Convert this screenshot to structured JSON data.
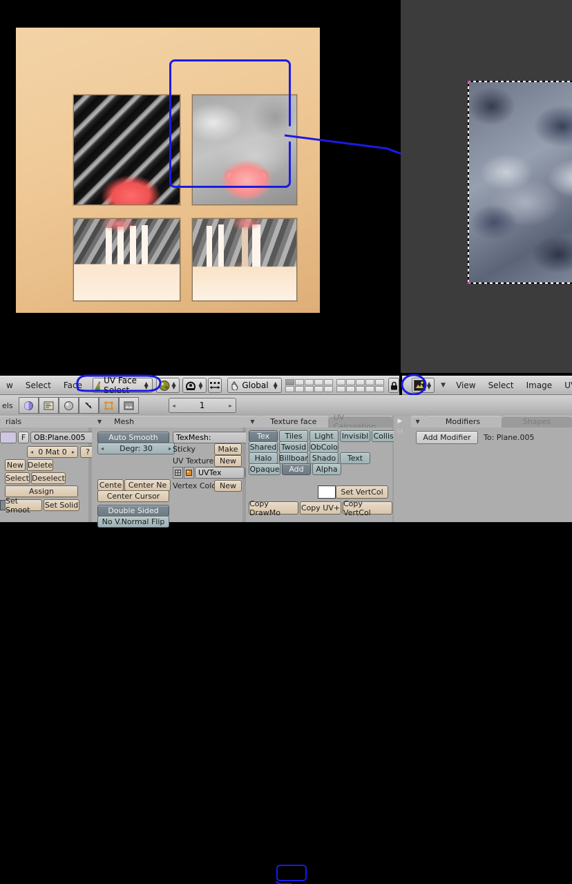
{
  "viewport3d": {
    "name": "3D View",
    "header": {
      "menus": [
        "w",
        "Select",
        "Face"
      ],
      "mode_selector": {
        "label": "UV Face Select",
        "icon": "uv-face-select-icon"
      },
      "draw_type": {
        "icon": "shading-textured-icon"
      },
      "pivot": {
        "icon": "rotate-manipulator-icon"
      },
      "manipulator": {
        "icon": "scale-manipulator-icon"
      },
      "transform_orientation": {
        "label": "Global",
        "icon": "hand-icon"
      },
      "layers_lock": {
        "icon": "lock-icon"
      },
      "layer_active_index": 0,
      "layer_count": 20
    },
    "faces": [
      {
        "name": "face-top-left",
        "label": "monkey on dark diagonal texture"
      },
      {
        "name": "face-top-right-selected",
        "label": "monkey on cloud texture"
      },
      {
        "name": "face-bottom-left",
        "label": "columns scene A"
      },
      {
        "name": "face-bottom-right",
        "label": "columns scene B"
      }
    ],
    "annotations": {
      "selection_box": "blue freehand box around selected face",
      "arrow": "blue arrow from selected face to image editor"
    }
  },
  "uv_editor": {
    "name": "UV/Image Editor",
    "header": {
      "editor_type_icon": "uv-image-editor-icon",
      "collapse_icon": "chevron-down-icon",
      "menus": [
        "View",
        "Select",
        "Image",
        "UVs"
      ]
    },
    "image": {
      "label": "cloud texture",
      "selected": true
    }
  },
  "buttons_header": {
    "left_label": "els",
    "context_icons": [
      {
        "name": "scene-icon",
        "active": false
      },
      {
        "name": "object-icon",
        "active": false
      },
      {
        "name": "shading-icon",
        "active": false
      },
      {
        "name": "object-constraints-icon",
        "active": false
      },
      {
        "name": "editing-icon",
        "active": true
      },
      {
        "name": "scripts-icon",
        "active": false
      }
    ],
    "frame_field": {
      "value": "1",
      "left_arrow": "◂",
      "right_arrow": "▸"
    }
  },
  "panels": {
    "link_and_materials": {
      "tab_label": "rials",
      "object_field": {
        "prefix": "F",
        "value": "OB:Plane.005"
      },
      "material_index": {
        "label": "0 Mat 0",
        "left_arrow": "◂",
        "right_arrow": "▸"
      },
      "help_button": "?",
      "buttons": [
        "New",
        "Delete",
        "Select",
        "Deselect"
      ],
      "assign": "Assign",
      "set_smooth": "Set Smoot",
      "set_solid": "Set Solid"
    },
    "mesh": {
      "tab_label": "Mesh",
      "auto_smooth": "Auto Smooth",
      "degr": {
        "label": "Degr: 30",
        "left_arrow": "◂",
        "right_arrow": "▸"
      },
      "center": "Cente",
      "center_new": "Center Ne",
      "center_cursor": "Center Cursor",
      "double_sided": "Double Sided",
      "no_vnormal_flip": "No V.Normal Flip",
      "texmesh": "TexMesh:",
      "sticky_label": "Sticky",
      "sticky_button": "Make",
      "uv_texture_label": "UV Texture",
      "uv_texture_button": "New",
      "uvtex_entry": "UVTex",
      "uvtex_delete_icon": "x-icon",
      "uvtex_grid_icon": "grid-icon",
      "uvtex_image_icon": "image-icon",
      "vertex_color_label": "Vertex Color",
      "vertex_color_button": "New"
    },
    "texture_face": {
      "tab_label": "Texture face",
      "tab_inactive_label": "UV Calculation",
      "row1": [
        {
          "label": "Tex",
          "active": true
        },
        {
          "label": "Tiles",
          "active": false
        },
        {
          "label": "Light",
          "active": false
        },
        {
          "label": "Invisibl",
          "active": false
        },
        {
          "label": "Collisio",
          "active": false
        }
      ],
      "row2": [
        {
          "label": "Shared",
          "active": false
        },
        {
          "label": "Twosid",
          "active": false
        },
        {
          "label": "ObColo",
          "active": false
        }
      ],
      "row3": [
        {
          "label": "Halo",
          "active": false
        },
        {
          "label": "Billboar",
          "active": false
        },
        {
          "label": "Shado",
          "active": false
        },
        {
          "label": "Text",
          "active": false
        }
      ],
      "row4": [
        {
          "label": "Opaque",
          "active": false
        },
        {
          "label": "Add",
          "active": true
        },
        {
          "label": "Alpha",
          "active": false
        }
      ],
      "vertcol_swatch_color": "#ffffff",
      "set_vertcol": "Set VertCol",
      "copy_drawmode": "Copy DrawMo",
      "copy_uv": "Copy UV+",
      "copy_vertcol": "Copy VertCol"
    },
    "modifiers": {
      "side_arrow_icon": "triangle-right-icon",
      "side_letter": "M",
      "tab_label": "Modifiers",
      "tab_inactive_label": "Shapes",
      "add_modifier": "Add Modifier",
      "target": "To: Plane.005"
    }
  },
  "colors": {
    "annotation_blue": "#1a1ae6",
    "panel_bg": "#adadad",
    "header_bg": "#c9c9c9",
    "viewport_bg": "#000000",
    "uv_editor_bg": "#3c3c3c",
    "button_tan": "#d9c5aa",
    "button_active": "#6d7a83"
  }
}
